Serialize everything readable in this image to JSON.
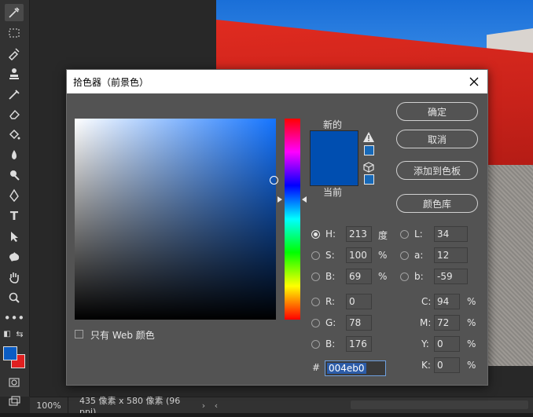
{
  "status": {
    "zoom": "100%",
    "doc_info": "435 像素 x 580 像素 (96 ppi)"
  },
  "dialog": {
    "title": "拾色器（前景色）",
    "new_label": "新的",
    "current_label": "当前",
    "buttons": {
      "ok": "确定",
      "cancel": "取消",
      "add_swatch": "添加到色板",
      "library": "颜色库"
    },
    "web_only": "只有 Web 颜色",
    "fields": {
      "H": {
        "label": "H:",
        "value": "213",
        "unit": "度"
      },
      "S": {
        "label": "S:",
        "value": "100",
        "unit": "%"
      },
      "Bv": {
        "label": "B:",
        "value": "69",
        "unit": "%"
      },
      "L": {
        "label": "L:",
        "value": "34"
      },
      "a": {
        "label": "a:",
        "value": "12"
      },
      "b": {
        "label": "b:",
        "value": "-59"
      },
      "R": {
        "label": "R:",
        "value": "0"
      },
      "G": {
        "label": "G:",
        "value": "78"
      },
      "B": {
        "label": "B:",
        "value": "176"
      },
      "C": {
        "label": "C:",
        "value": "94",
        "unit": "%"
      },
      "M": {
        "label": "M:",
        "value": "72",
        "unit": "%"
      },
      "Y": {
        "label": "Y:",
        "value": "0",
        "unit": "%"
      },
      "K": {
        "label": "K:",
        "value": "0",
        "unit": "%"
      }
    },
    "hex_label": "#",
    "hex_value": "004eb0",
    "colors": {
      "selected": "#004eb0",
      "foreground": "#0a5cc4",
      "background": "#e02020"
    }
  }
}
